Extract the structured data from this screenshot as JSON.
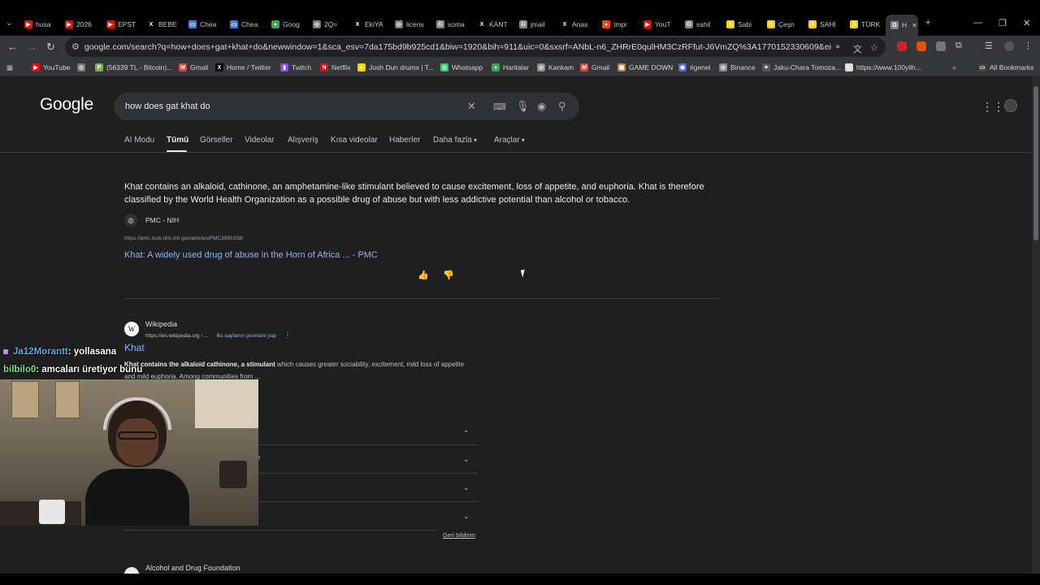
{
  "browser": {
    "tabs": [
      {
        "label": "husa",
        "color": "#ff0000",
        "glyph": "▶"
      },
      {
        "label": "2026",
        "color": "#ff0000",
        "glyph": "▶"
      },
      {
        "label": "EPST",
        "color": "#ff0000",
        "glyph": "▶"
      },
      {
        "label": "BEBE",
        "color": "#000000",
        "glyph": "X"
      },
      {
        "label": "Chea",
        "color": "#4a7bd6",
        "glyph": "▭"
      },
      {
        "label": "Chea",
        "color": "#4a7bd6",
        "glyph": "▭"
      },
      {
        "label": "Goog",
        "color": "#34a853",
        "glyph": "●"
      },
      {
        "label": "2Q=",
        "color": "#777777",
        "glyph": "◎"
      },
      {
        "label": "EkiYA",
        "color": "#000000",
        "glyph": "X"
      },
      {
        "label": "licens",
        "color": "#777777",
        "glyph": "◎"
      },
      {
        "label": "soma",
        "color": "#888888",
        "glyph": "G"
      },
      {
        "label": "KANT",
        "color": "#000000",
        "glyph": "X"
      },
      {
        "label": "jmail",
        "color": "#888888",
        "glyph": "G"
      },
      {
        "label": "Anas",
        "color": "#000000",
        "glyph": "X"
      },
      {
        "label": "Impr",
        "color": "#ff4500",
        "glyph": "●"
      },
      {
        "label": "YouT",
        "color": "#ff0000",
        "glyph": "▶"
      },
      {
        "label": "sahil",
        "color": "#888888",
        "glyph": "G"
      },
      {
        "label": "Sabi",
        "color": "#f5d400",
        "glyph": "S"
      },
      {
        "label": "Çeşn",
        "color": "#f5d400",
        "glyph": "S"
      },
      {
        "label": "SAHİ",
        "color": "#f5d400",
        "glyph": "S"
      },
      {
        "label": "TÜRK",
        "color": "#f5d400",
        "glyph": "S"
      },
      {
        "label": "H",
        "color": "#888888",
        "glyph": "G",
        "active": true
      }
    ],
    "new_tab": "+",
    "window_controls": {
      "minimize": "—",
      "restore": "❐",
      "close": "✕"
    },
    "url": "google.com/search?q=how+does+gat+khat+do&newwindow=1&sca_esv=7da175bd9b925cd1&biw=1920&bih=911&uic=0&sxsrf=ANbL-n6_ZHRrE0qulHM3CzRFfut-J6VmZQ%3A1770152330609&ei=imGCabvpJPKehbl...",
    "bookmarks": [
      {
        "label": "YouTube",
        "color": "#ff0000",
        "glyph": "▶"
      },
      {
        "label": "",
        "color": "#777777",
        "glyph": "◎"
      },
      {
        "label": "(56339 TL - Bitcoin)...",
        "color": "#7cb342",
        "glyph": "P"
      },
      {
        "label": "Gmail",
        "color": "#ea4335",
        "glyph": "M"
      },
      {
        "label": "Home / Twitter",
        "color": "#000000",
        "glyph": "X"
      },
      {
        "label": "Twitch",
        "color": "#9146ff",
        "glyph": "▮"
      },
      {
        "label": "Netflix",
        "color": "#e50914",
        "glyph": "N"
      },
      {
        "label": "Josh Dun drums | T...",
        "color": "#f5d400",
        "glyph": "●"
      },
      {
        "label": "Whatsapp",
        "color": "#25d366",
        "glyph": "◎"
      },
      {
        "label": "Haritalar",
        "color": "#34a853",
        "glyph": "●"
      },
      {
        "label": "Kankam",
        "color": "#888888",
        "glyph": "◎"
      },
      {
        "label": "Gmail",
        "color": "#ea4335",
        "glyph": "M"
      },
      {
        "label": "GAME DOWN",
        "color": "#c77d3a",
        "glyph": "▣"
      },
      {
        "label": "#genel",
        "color": "#5865f2",
        "glyph": "◉"
      },
      {
        "label": "Binance",
        "color": "#888888",
        "glyph": "◎"
      },
      {
        "label": "Jaku-Chara Tomoza...",
        "color": "#555555",
        "glyph": "✦"
      },
      {
        "label": "https://www.100yilh...",
        "color": "#dddddd",
        "glyph": "◐"
      }
    ],
    "all_bookmarks": "All Bookmarks"
  },
  "google": {
    "logo": "Google",
    "query": "how does gat khat do",
    "nav_tabs": [
      "AI Modu",
      "Tümü",
      "Görseller",
      "Videolar",
      "Alışveriş",
      "Kısa videolar",
      "Haberler",
      "Daha fazla",
      "Araçlar"
    ],
    "featured": {
      "snippet": "Khat contains an alkaloid, cathinone, an amphetamine-like stimulant believed to cause excitement, loss of appetite, and euphoria. Khat is therefore classified by the World Health Organization as a possible drug of abuse but with less addictive potential than alcohol or tobacco.",
      "source_name": "PMC - NIH",
      "source_url": "https://pmc.ncbi.nlm.nih.gov/articles/PMC3991038/",
      "link_title": "Khat: A widely used drug of abuse in the Horn of Africa ... - PMC"
    },
    "result1": {
      "site_name": "Wikipedia",
      "favicon_letter": "W",
      "url": "https://en.wikipedia.org › ...",
      "translate": "Bu sayfanın çevirisini yap",
      "title": "Khat",
      "snippet_bold": "Khat contains the alkaloid cathinone, a stimulant",
      "snippet_rest": " which causes greater sociability, excitement, mild loss of appetite and mild euphoria. Among communities from ..."
    },
    "paa_tail_glyph": "?",
    "feedback": "Geri bildirim",
    "next_result_site": "Alcohol and Drug Foundation"
  },
  "stream": {
    "chat": [
      {
        "user": "Ja12Morantt",
        "message": ": yollasana"
      },
      {
        "user": "bilbilo0",
        "message": ": amcaları üretiyor bunu"
      }
    ]
  }
}
